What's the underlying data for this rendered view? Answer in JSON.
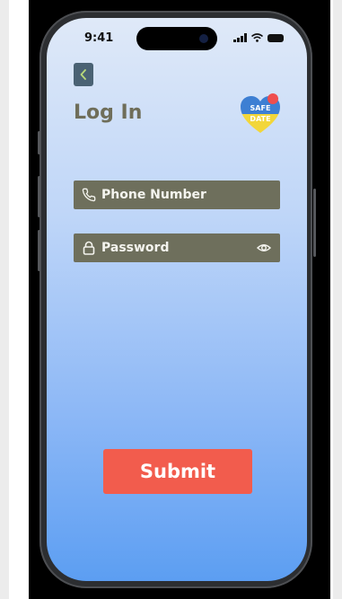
{
  "status_bar": {
    "time": "9:41",
    "signal_icon": "cellular-signal-icon",
    "wifi_icon": "wifi-icon",
    "battery_icon": "battery-icon"
  },
  "header": {
    "back_icon": "chevron-left-icon",
    "title": "Log In"
  },
  "logo": {
    "line1": "SAFE",
    "line2": "DATE",
    "colors": {
      "top": "#3d7fd3",
      "bottom": "#f2d63a",
      "badge": "#ef4e4e"
    }
  },
  "form": {
    "phone": {
      "label": "Phone Number",
      "icon": "phone-icon"
    },
    "password": {
      "label": "Password",
      "icon": "lock-icon",
      "toggle_icon": "eye-icon"
    },
    "submit_label": "Submit"
  },
  "colors": {
    "field_bg": "#6e6f5c",
    "title": "#6f6e5a",
    "submit_bg": "#f25c4d",
    "back_button_bg": "#4a6274"
  }
}
